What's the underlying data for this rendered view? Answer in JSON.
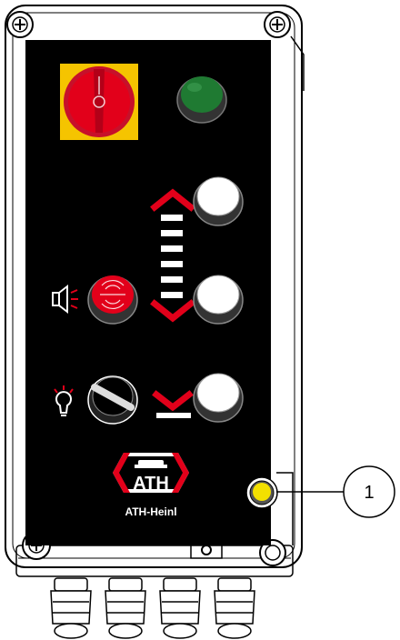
{
  "brand": {
    "logo_text": "ATH",
    "name": "ATH-Heinl"
  },
  "callout": {
    "number": "1"
  },
  "controls": {
    "main_switch": "main-switch-red-yellow",
    "indicator_lamp": "green-indicator-lamp",
    "up_button": "white-push-button",
    "emergency_button": "red-signal-button",
    "down_button": "white-push-button",
    "light_selector": "rotary-selector-switch",
    "status_led": "yellow-status-led"
  },
  "icons": {
    "arrow_up": "chevron-up-icon",
    "arrow_down": "chevron-down-icon",
    "horn": "horn-icon",
    "lamp": "light-bulb-icon"
  },
  "colors": {
    "panel": "#000000",
    "housing": "#ffffff",
    "accent_red": "#e2001a",
    "switch_yellow": "#f5c400",
    "lamp_green": "#1f7a32",
    "led_yellow": "#f3e000"
  }
}
